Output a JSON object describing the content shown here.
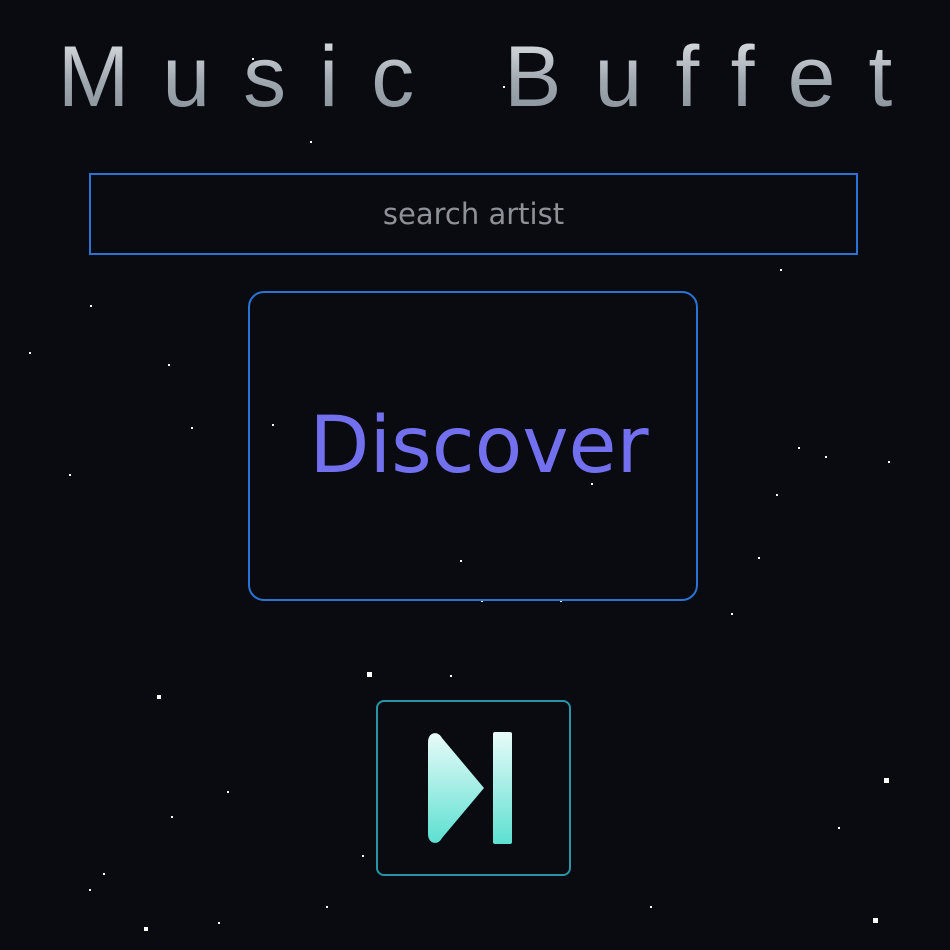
{
  "app": {
    "title": "Music Buffet"
  },
  "search": {
    "placeholder": "search artist",
    "value": ""
  },
  "discover": {
    "label": "Discover"
  },
  "controls": {
    "next_icon": "skip-next-icon"
  },
  "colors": {
    "background": "#090b10",
    "accent_blue": "#2b72d6",
    "discover_text": "#7370f0",
    "next_border": "#2a93a6",
    "next_icon_top": "#e8fbf8",
    "next_icon_bottom": "#5fe0d2"
  }
}
